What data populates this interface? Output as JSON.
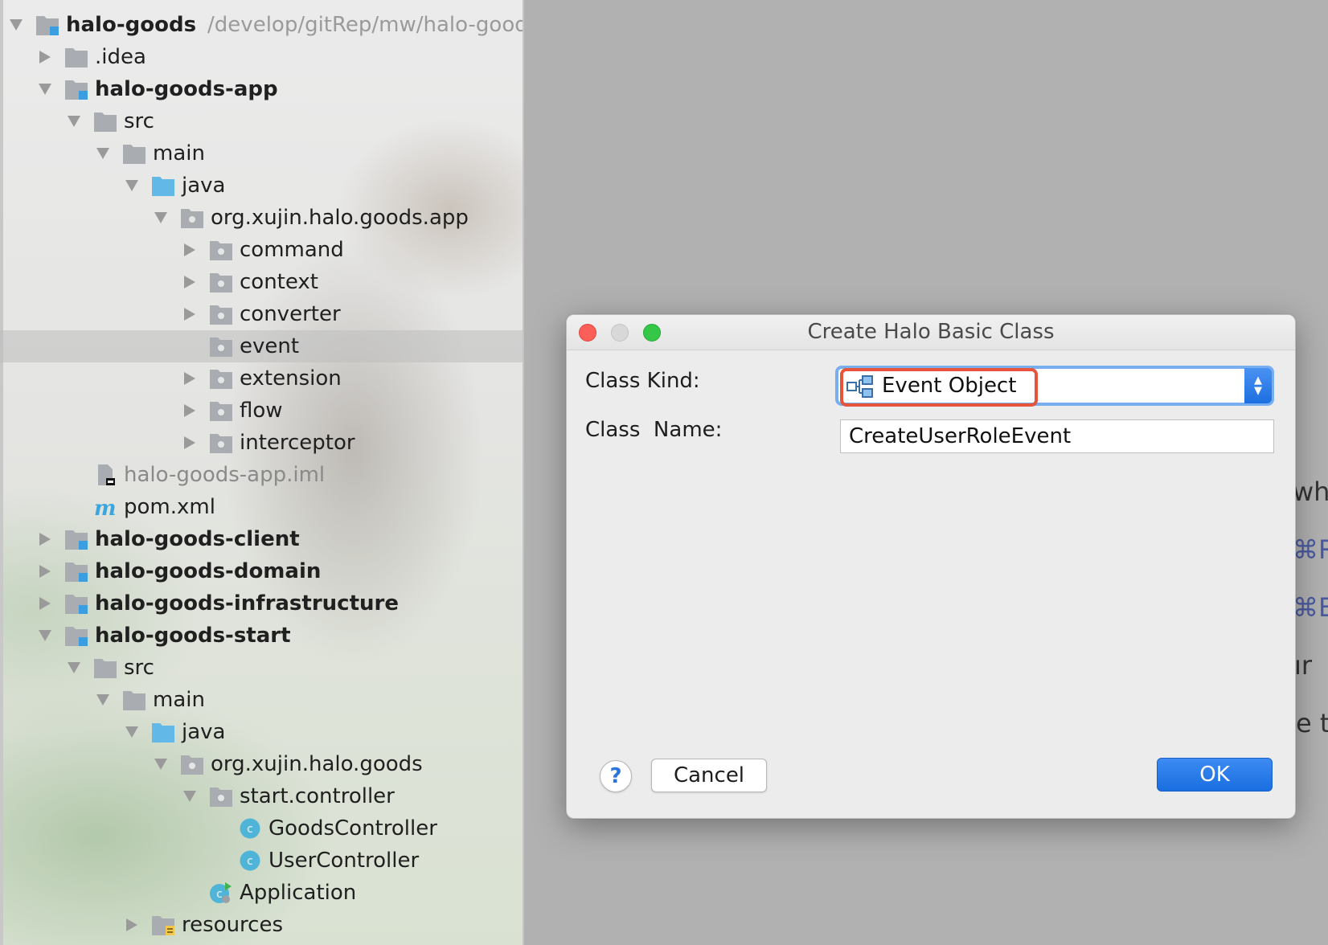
{
  "project_tree": {
    "root": {
      "label": "halo-goods",
      "path_hint": "/develop/gitRep/mw/halo-goods"
    },
    "items": [
      {
        "label": ".idea"
      },
      {
        "label": "halo-goods-app"
      },
      {
        "label": "src"
      },
      {
        "label": "main"
      },
      {
        "label": "java"
      },
      {
        "label": "org.xujin.halo.goods.app"
      },
      {
        "label": "command"
      },
      {
        "label": "context"
      },
      {
        "label": "converter"
      },
      {
        "label": "event"
      },
      {
        "label": "extension"
      },
      {
        "label": "flow"
      },
      {
        "label": "interceptor"
      },
      {
        "label": "halo-goods-app.iml"
      },
      {
        "label": "pom.xml"
      },
      {
        "label": "halo-goods-client"
      },
      {
        "label": "halo-goods-domain"
      },
      {
        "label": "halo-goods-infrastructure"
      },
      {
        "label": "halo-goods-start"
      },
      {
        "label": "src"
      },
      {
        "label": "main"
      },
      {
        "label": "java"
      },
      {
        "label": "org.xujin.halo.goods"
      },
      {
        "label": "start.controller"
      },
      {
        "label": "GoodsController"
      },
      {
        "label": "UserController"
      },
      {
        "label": "Application"
      },
      {
        "label": "resources"
      }
    ],
    "selected_item": "event"
  },
  "background_fragments": [
    "wh",
    "⌘R",
    "⌘E",
    "ır",
    "e t"
  ],
  "dialog": {
    "title": "Create Halo Basic Class",
    "class_kind_label": "Class Kind:",
    "class_kind_value": "Event Object",
    "class_name_label": "Class  Name:",
    "class_name_value": "CreateUserRoleEvent",
    "help_glyph": "?",
    "cancel_label": "Cancel",
    "ok_label": "OK"
  },
  "colors": {
    "accent_blue": "#1a6ee0",
    "highlight_red": "#e8533c",
    "folder_blue": "#62b8e6",
    "folder_gray": "#a9adb2"
  }
}
